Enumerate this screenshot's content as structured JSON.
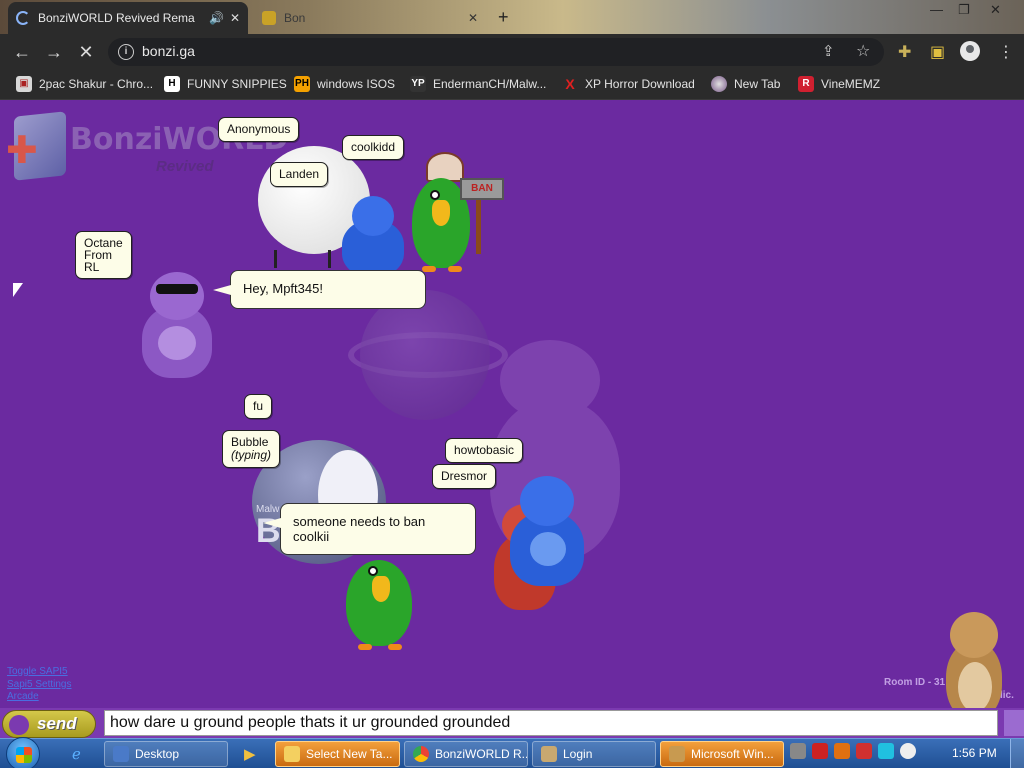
{
  "browser": {
    "tabs": [
      {
        "title": "BonziWORLD Revived Rema",
        "active": true
      },
      {
        "title": "Bon",
        "active": false
      }
    ],
    "url": "bonzi.ga",
    "bookmarks": [
      {
        "label": "2pac Shakur - Chro...",
        "icon": "2pac-favicon"
      },
      {
        "label": "FUNNY SNIPPIES",
        "icon": "H"
      },
      {
        "label": "windows ISOS",
        "icon": "PH"
      },
      {
        "label": "EndermanCH/Malw...",
        "icon": "YP"
      },
      {
        "label": "XP Horror Download",
        "icon": "X"
      },
      {
        "label": "New Tab",
        "icon": "globe-favicon"
      },
      {
        "label": "VineMEMZ",
        "icon": "R"
      }
    ],
    "window_controls": [
      "minimize",
      "maximize",
      "close"
    ]
  },
  "page": {
    "logo": {
      "text": "BonziWORLD",
      "subtext": "Revived"
    },
    "nametags": {
      "anonymous": "Anonymous",
      "coolkidd": "coolkidd",
      "landen": "Landen",
      "octane": "Octane\nFrom\nRL",
      "fu": "fu",
      "bubble": "Bubble",
      "bubble_status": "(typing)",
      "howtobasic": "howtobasic",
      "dresmor": "Dresmor"
    },
    "bubbles": {
      "octane_msg": "Hey, Mpft345!",
      "bubble_msg": "someone needs to ban coolkii"
    },
    "ban_sign": "BAN",
    "links": [
      "Toggle SAPI5",
      "Sapi5 Settings",
      "Arcade"
    ],
    "room_id_label": "Room ID - 31",
    "room_id_tail": "lic."
  },
  "chat": {
    "send_label": "send",
    "input_value": "how dare u ground people thats it ur grounded grounded"
  },
  "taskbar": {
    "tasks": [
      {
        "label": "Desktop"
      },
      {
        "label": "Select New Ta..."
      },
      {
        "label": "BonziWORLD R..."
      },
      {
        "label": "Login"
      },
      {
        "label": "Microsoft Win..."
      }
    ],
    "clock": "1:56 PM"
  },
  "colors": {
    "page_bg": "#6b2aa0",
    "bonzi_purple": "#8c58c4",
    "bonzi_blue": "#2a5fd8",
    "parrot_green": "#2aa52a",
    "taskbar": "#2a5fa6"
  }
}
